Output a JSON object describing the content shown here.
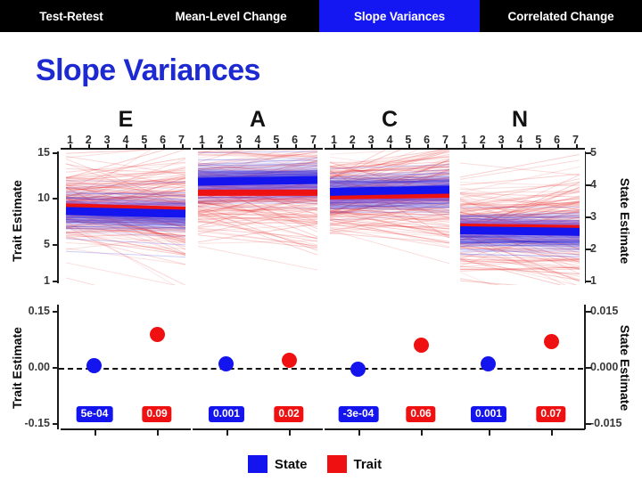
{
  "nav": {
    "tabs": [
      {
        "label": "Test-Retest",
        "active": false
      },
      {
        "label": "Mean-Level Change",
        "active": false
      },
      {
        "label": "Slope Variances",
        "active": true
      },
      {
        "label": "Correlated Change",
        "active": false
      }
    ],
    "active_bg": "#1517f2",
    "bar_bg": "#000000",
    "text_color": "#ffffff"
  },
  "slide": {
    "title": "Slope Variances",
    "title_color": "#1d2ad1"
  },
  "legend": {
    "items": [
      {
        "label": "State",
        "color": "#1414ef"
      },
      {
        "label": "Trait",
        "color": "#ef1111"
      }
    ]
  },
  "axes": {
    "top_left_title": "Trait Estimate",
    "top_right_title": "State Estimate",
    "bottom_left_title": "Trait Estimate",
    "bottom_right_title": "State Estimate",
    "top_left_ticks": [
      "15",
      "10",
      "5",
      "1"
    ],
    "top_right_ticks": [
      "5",
      "4",
      "3",
      "2",
      "1"
    ],
    "bottom_left_ticks": [
      "0.15",
      "0.00",
      "-0.15"
    ],
    "bottom_right_ticks": [
      "0.015",
      "0.000",
      "-0.015"
    ],
    "x_ticks": [
      "1",
      "2",
      "3",
      "4",
      "5",
      "6",
      "7"
    ]
  },
  "chart_data": {
    "type": "line",
    "title": "Slope Variances",
    "xlabel": "",
    "ylabel": "Trait Estimate",
    "y2label": "State Estimate",
    "x": [
      1,
      2,
      3,
      4,
      5,
      6,
      7
    ],
    "panels": [
      {
        "name": "E",
        "trait_mean_intercept": 8.8,
        "trait_mean_slope": -0.06,
        "state_mean_intercept": 8.3,
        "state_mean_slope": -0.05,
        "trait_variance": 0.09,
        "state_variance": 0.0005,
        "trait_variance_label": "0.09",
        "state_variance_label": "5e-04",
        "trait_point_value": 0.09,
        "state_point_value": 0.0005
      },
      {
        "name": "A",
        "trait_mean_intercept": 10.3,
        "trait_mean_slope": 0.0,
        "state_mean_intercept": 11.5,
        "state_mean_slope": 0.03,
        "trait_variance": 0.02,
        "state_variance": 0.001,
        "trait_variance_label": "0.02",
        "state_variance_label": "0.001",
        "trait_point_value": 0.02,
        "state_point_value": 0.001
      },
      {
        "name": "C",
        "trait_mean_intercept": 9.9,
        "trait_mean_slope": 0.03,
        "state_mean_intercept": 10.4,
        "state_mean_slope": 0.04,
        "trait_variance": 0.06,
        "state_variance": -0.0003,
        "trait_variance_label": "0.06",
        "state_variance_label": "-3e-04",
        "trait_point_value": 0.06,
        "state_point_value": -0.0003
      },
      {
        "name": "N",
        "trait_mean_intercept": 6.6,
        "trait_mean_slope": -0.03,
        "state_mean_intercept": 6.2,
        "state_mean_slope": -0.03,
        "trait_variance": 0.07,
        "state_variance": 0.001,
        "trait_variance_label": "0.07",
        "state_variance_label": "0.001",
        "trait_point_value": 0.07,
        "state_point_value": 0.001
      }
    ],
    "top_ylim_trait": [
      1,
      15
    ],
    "top_ylim_state": [
      1,
      5
    ],
    "bottom_ylim_trait": [
      -0.15,
      0.15
    ],
    "bottom_ylim_state": [
      -0.015,
      0.015
    ],
    "bottom_zero_reference": 0,
    "grid": false,
    "legend_position": "bottom-center"
  }
}
